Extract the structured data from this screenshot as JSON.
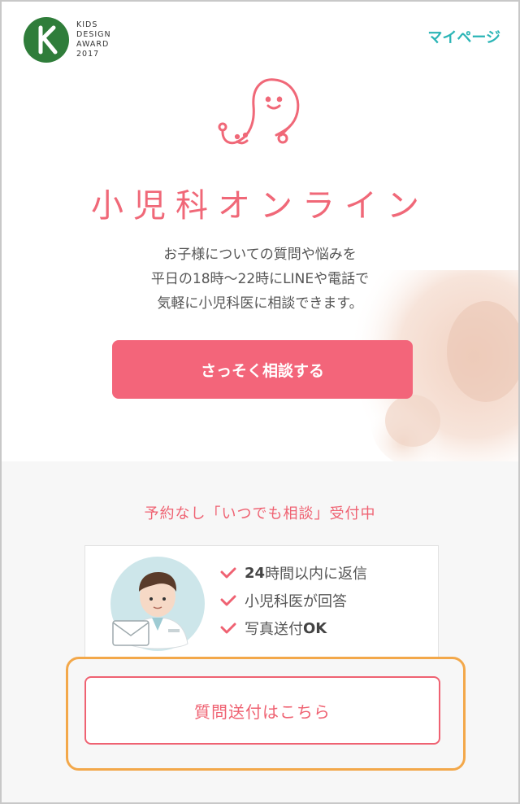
{
  "header": {
    "award_lines": [
      "KIDS",
      "DESIGN",
      "AWARD",
      "2017"
    ],
    "award_letter": "K",
    "mypage_label": "マイページ"
  },
  "hero": {
    "brand_title": "小児科オンライン",
    "lead_lines": [
      "お子様についての質問や悩みを",
      "平日の18時〜22時にLINEや電話で",
      "気軽に小児科医に相談できます。"
    ],
    "cta_label": "さっそく相談する"
  },
  "lower": {
    "subtitle": "予約なし「いつでも相談」受付中",
    "features": [
      {
        "strong": "24",
        "text": "時間以内に返信"
      },
      {
        "strong": "",
        "text": "小児科医が回答"
      },
      {
        "strong": "",
        "text": "写真送付",
        "strong_after": "OK"
      }
    ],
    "question_button": "質問送付はこちら"
  },
  "colors": {
    "accent": "#f3657a",
    "teal": "#2bb5b6",
    "award_green": "#2f7d3a",
    "highlight": "#f3a84a"
  }
}
